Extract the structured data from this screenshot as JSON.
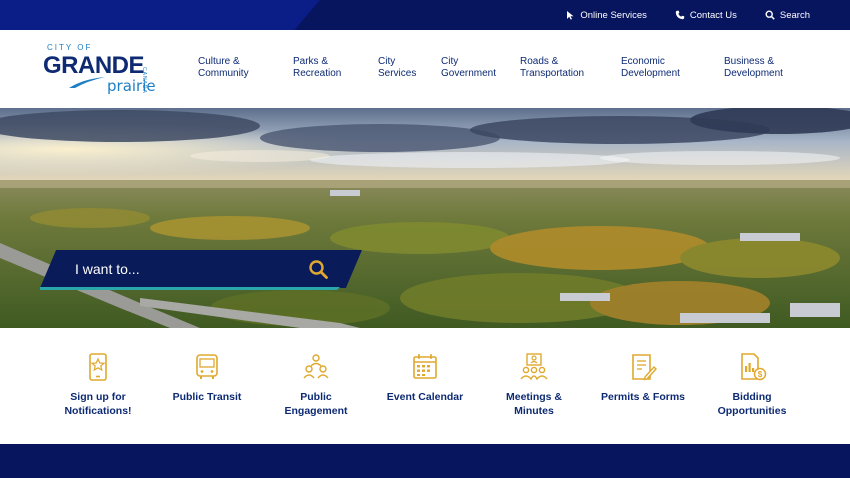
{
  "colors": {
    "navy": "#07145e",
    "brand_blue": "#0d2a73",
    "accent_teal": "#2aa7a8",
    "icon_gold": "#e0a82e"
  },
  "topbar": {
    "links": [
      {
        "label": "Online Services",
        "icon": "cursor-icon"
      },
      {
        "label": "Contact Us",
        "icon": "phone-icon"
      },
      {
        "label": "Search",
        "icon": "search-icon"
      }
    ]
  },
  "logo": {
    "city_of": "CITY OF",
    "grande": "GRANDE",
    "prairie": "prairie",
    "canada": "CANADA"
  },
  "nav": {
    "items": [
      {
        "label": "Culture &\nCommunity"
      },
      {
        "label": "Parks &\nRecreation"
      },
      {
        "label": "City\nServices"
      },
      {
        "label": "City\nGovernment"
      },
      {
        "label": "Roads &\nTransportation"
      },
      {
        "label": "Economic\nDevelopment"
      },
      {
        "label": "Business &\nDevelopment"
      }
    ]
  },
  "hero": {
    "i_want_to": "I want to...",
    "search_icon": "search-icon"
  },
  "quick_links": [
    {
      "label": "Sign up for\nNotifications!",
      "icon": "phone-star-icon"
    },
    {
      "label": "Public Transit",
      "icon": "bus-icon"
    },
    {
      "label": "Public\nEngagement",
      "icon": "people-group-icon"
    },
    {
      "label": "Event Calendar",
      "icon": "calendar-icon"
    },
    {
      "label": "Meetings &\nMinutes",
      "icon": "meeting-icon"
    },
    {
      "label": "Permits & Forms",
      "icon": "form-pencil-icon"
    },
    {
      "label": "Bidding\nOpportunities",
      "icon": "document-dollar-icon"
    }
  ]
}
